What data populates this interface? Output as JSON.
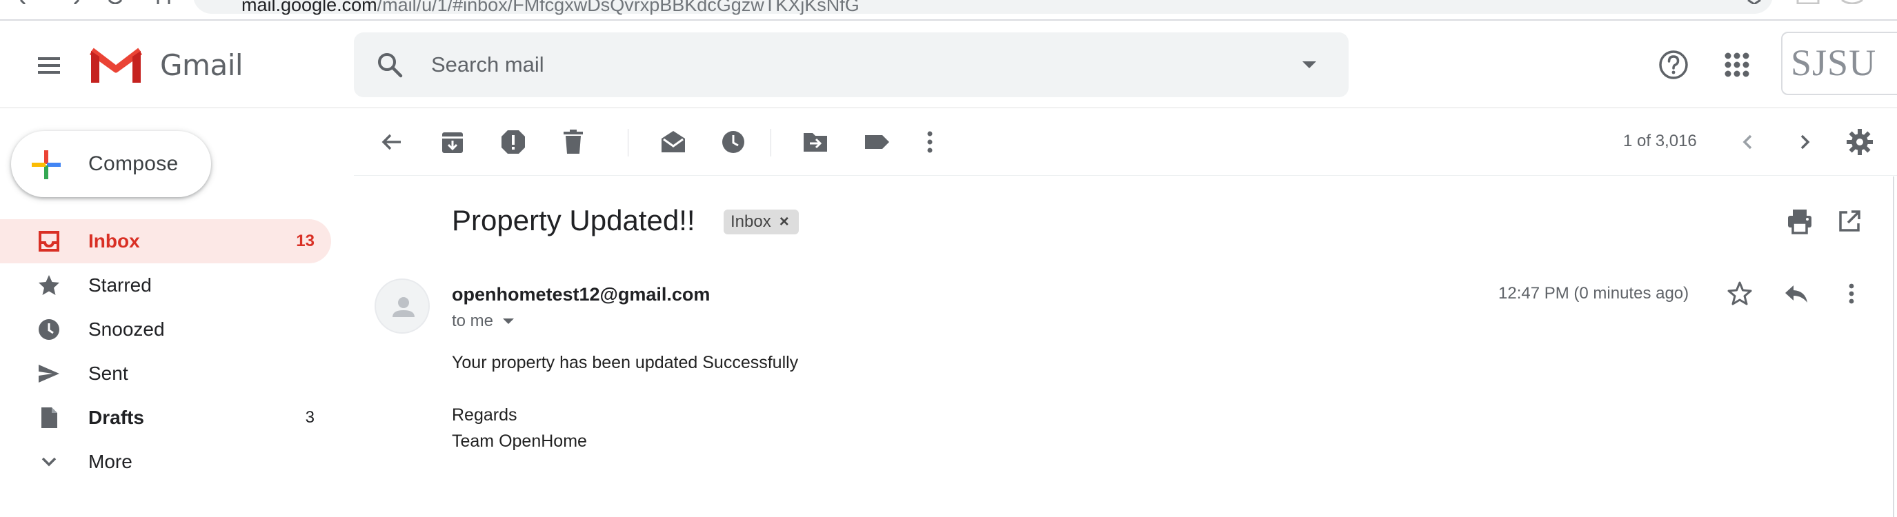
{
  "browser": {
    "url_host": "mail.google.com",
    "url_path": "/mail/u/1/#inbox/FMfcgxwDsQvrxpBBKdcGgzwTKXjKsNfG"
  },
  "header": {
    "app_name": "Gmail",
    "search_placeholder": "Search mail",
    "account_label": "SJSU"
  },
  "sidebar": {
    "compose_label": "Compose",
    "items": [
      {
        "label": "Inbox",
        "count": "13",
        "icon": "inbox-icon"
      },
      {
        "label": "Starred",
        "count": "",
        "icon": "star-icon"
      },
      {
        "label": "Snoozed",
        "count": "",
        "icon": "clock-icon"
      },
      {
        "label": "Sent",
        "count": "",
        "icon": "send-icon"
      },
      {
        "label": "Drafts",
        "count": "3",
        "icon": "draft-icon"
      },
      {
        "label": "More",
        "count": "",
        "icon": "chevron-down-icon"
      }
    ]
  },
  "toolbar": {
    "pager": "1 of 3,016"
  },
  "message": {
    "subject": "Property Updated!!",
    "label": "Inbox",
    "label_close": "×",
    "sender": "openhometest12@gmail.com",
    "recipient": "to me",
    "timestamp": "12:47 PM (0 minutes ago)",
    "body_lines": [
      "Your property has been updated Successfully",
      "",
      "Regards",
      "Team OpenHome"
    ]
  },
  "colors": {
    "accent_red": "#d93025",
    "active_bg": "#fce8e6",
    "search_bg": "#f1f3f4"
  }
}
